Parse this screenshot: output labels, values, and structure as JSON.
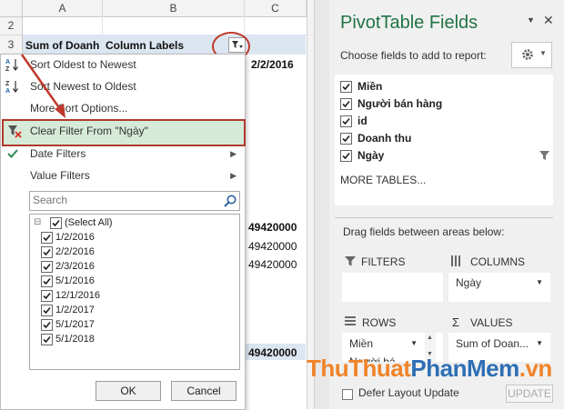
{
  "sheet": {
    "columns": [
      "A",
      "B",
      "C"
    ],
    "rows": [
      "2",
      "3"
    ],
    "pivot_header_label": "Sum of Doanh",
    "column_labels": "Column Labels",
    "first_date": "2/2/2016",
    "values": [
      "49420000",
      "49420000",
      "49420000",
      "49420000"
    ]
  },
  "menu": {
    "sort_oldest": "Sort Oldest to Newest",
    "sort_newest": "Sort Newest to Oldest",
    "more_sort": "More Sort Options...",
    "clear_filter": "Clear Filter From \"Ngày\"",
    "date_filters": "Date Filters",
    "value_filters": "Value Filters",
    "search_placeholder": "Search",
    "items": [
      "(Select All)",
      "1/2/2016",
      "2/2/2016",
      "2/3/2016",
      "5/1/2016",
      "12/1/2016",
      "1/2/2017",
      "5/1/2017",
      "5/1/2018"
    ],
    "ok": "OK",
    "cancel": "Cancel"
  },
  "pane": {
    "title": "PivotTable Fields",
    "choose_label": "Choose fields to add to report:",
    "fields": [
      "Miền",
      "Người bán hàng",
      "id",
      "Doanh thu",
      "Ngày"
    ],
    "more_tables": "MORE TABLES...",
    "drag_label": "Drag fields between areas below:",
    "filters": "FILTERS",
    "columns": "COLUMNS",
    "rows": "ROWS",
    "values": "VALUES",
    "columns_item": "Ngày",
    "rows_item_1": "Miền",
    "rows_item_2": "Người bá...",
    "values_item": "Sum of Doan...",
    "defer": "Defer Layout Update",
    "update": "UPDATE"
  },
  "watermark": {
    "part1": "ThuThuat",
    "part2": "PhanMem",
    "part3": ".vn"
  },
  "colors": {
    "excel_green": "#217346",
    "highlight_red": "#b03a2e",
    "pivot_blue": "#dce6f1",
    "clear_highlight": "#d6ead8"
  }
}
